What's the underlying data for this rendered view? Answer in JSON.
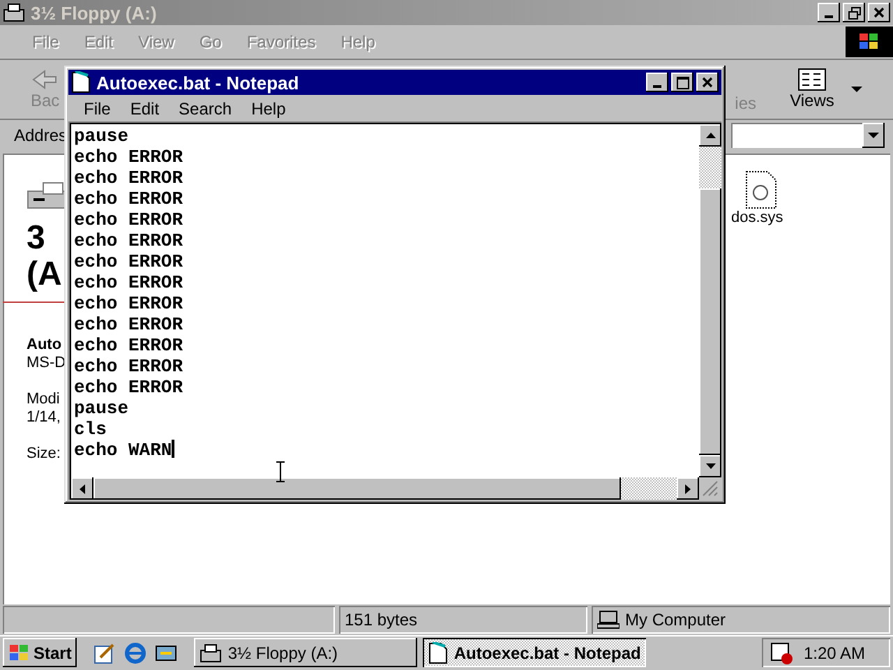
{
  "explorer": {
    "title": "3½ Floppy (A:)",
    "menu": [
      "File",
      "Edit",
      "View",
      "Go",
      "Favorites",
      "Help"
    ],
    "toolbar": [
      {
        "label": "Bac"
      },
      {
        "label": "ies"
      },
      {
        "label": "Views"
      }
    ],
    "address_label": "Addres",
    "folder_title": [
      "3",
      "(A"
    ],
    "details": [
      "Auto",
      "MS-D",
      "Modi",
      "1/14,",
      "Size:"
    ],
    "files": [
      "dos.sys"
    ],
    "status_bar": [
      "151 bytes",
      "My Computer"
    ]
  },
  "notepad": {
    "title": "Autoexec.bat - Notepad",
    "menu": [
      "File",
      "Edit",
      "Search",
      "Help"
    ],
    "lines": [
      "pause",
      "echo ERROR",
      "echo ERROR",
      "echo ERROR",
      "echo ERROR",
      "echo ERROR",
      "echo ERROR",
      "echo ERROR",
      "echo ERROR",
      "echo ERROR",
      "echo ERROR",
      "echo ERROR",
      "echo ERROR",
      "pause",
      "cls",
      "echo WARN"
    ]
  },
  "taskbar": {
    "start": "Start",
    "tasks": [
      {
        "label": "3½ Floppy (A:)",
        "selected": false
      },
      {
        "label": "Autoexec.bat - Notepad",
        "selected": true
      }
    ],
    "clock": "1:20 AM"
  }
}
